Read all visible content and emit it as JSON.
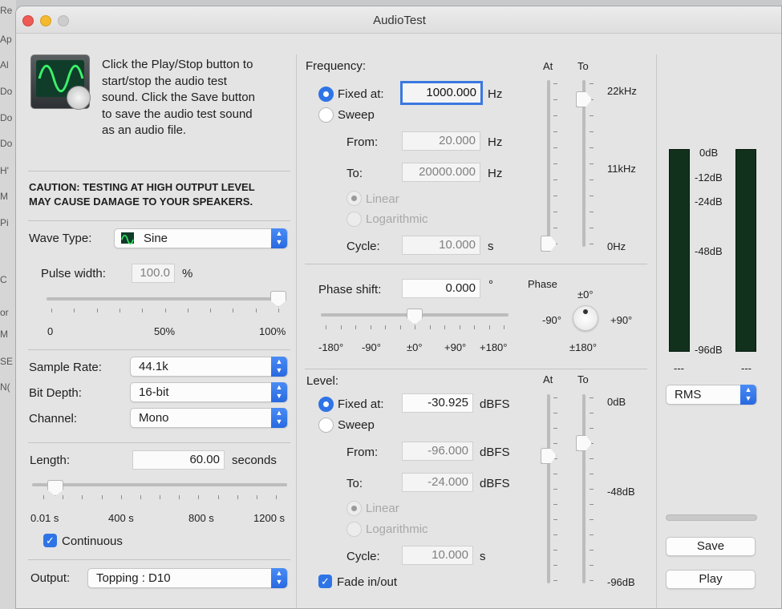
{
  "window": {
    "title": "AudioTest"
  },
  "background": {
    "partial_texts": [
      "Re",
      "Ap",
      "Al",
      "Do",
      "Do",
      "Do",
      "H'",
      "M",
      "Pi",
      "C",
      "or",
      "M",
      "SE",
      "N("
    ]
  },
  "info": {
    "text_lines": [
      "Click the Play/Stop button to",
      "start/stop the audio test",
      "sound. Click the Save button",
      "to save the audio test sound",
      "as an audio file."
    ]
  },
  "caution": {
    "line1": "CAUTION: TESTING AT HIGH OUTPUT LEVEL",
    "line2": "MAY CAUSE DAMAGE TO YOUR SPEAKERS."
  },
  "wave": {
    "label": "Wave Type:",
    "value": "Sine",
    "pulse_label": "Pulse width:",
    "pulse_value": "100.0",
    "pulse_unit": "%",
    "pulse_ticks": [
      "0",
      "50%",
      "100%"
    ],
    "pulse_position": 1.0
  },
  "format": {
    "sample_rate_label": "Sample Rate:",
    "sample_rate": "44.1k",
    "bit_depth_label": "Bit Depth:",
    "bit_depth": "16-bit",
    "channel_label": "Channel:",
    "channel": "Mono"
  },
  "length": {
    "label": "Length:",
    "value": "60.00",
    "unit": "seconds",
    "ticks": [
      "0.01 s",
      "400 s",
      "800 s",
      "1200 s"
    ],
    "position": 0.05,
    "continuous_label": "Continuous",
    "continuous": true
  },
  "output": {
    "label": "Output:",
    "device": "Topping : D10"
  },
  "frequency": {
    "title": "Frequency:",
    "fixed_label": "Fixed at:",
    "fixed_value": "1000.000",
    "unit": "Hz",
    "sweep_label": "Sweep",
    "from_label": "From:",
    "from_value": "20.000",
    "to_label": "To:",
    "to_value": "20000.000",
    "linear_label": "Linear",
    "log_label": "Logarithmic",
    "cycle_label": "Cycle:",
    "cycle_value": "10.000",
    "cycle_unit": "s",
    "at_label": "At",
    "to_col_label": "To",
    "scale": [
      "22kHz",
      "11kHz",
      "0Hz"
    ],
    "at_position": 0.0,
    "to_position": 0.9
  },
  "phase": {
    "label": "Phase shift:",
    "value": "0.000",
    "unit": "°",
    "ticks": [
      "-180°",
      "-90°",
      "±0°",
      "+90°",
      "+180°"
    ],
    "slider_position": 0.5,
    "knob_title": "Phase",
    "knob_top": "±0°",
    "knob_left": "-90°",
    "knob_right": "+90°",
    "knob_bottom": "±180°"
  },
  "level": {
    "title": "Level:",
    "fixed_label": "Fixed at:",
    "fixed_value": "-30.925",
    "unit": "dBFS",
    "sweep_label": "Sweep",
    "from_label": "From:",
    "from_value": "-96.000",
    "to_label": "To:",
    "to_value": "-24.000",
    "linear_label": "Linear",
    "log_label": "Logarithmic",
    "cycle_label": "Cycle:",
    "cycle_value": "10.000",
    "cycle_unit": "s",
    "fade_label": "Fade in/out",
    "fade": true,
    "at_label": "At",
    "to_col_label": "To",
    "scale": [
      "0dB",
      "-48dB",
      "-96dB"
    ],
    "at_position": 0.68,
    "to_position": 0.75
  },
  "meter": {
    "scale": [
      "0dB",
      "-12dB",
      "-24dB",
      "-48dB",
      "-96dB"
    ],
    "left_readout": "---",
    "right_readout": "---",
    "mode": "RMS"
  },
  "buttons": {
    "save": "Save",
    "play": "Play"
  },
  "colors": {
    "accent": "#2f74e6",
    "meter": "#11311c"
  }
}
